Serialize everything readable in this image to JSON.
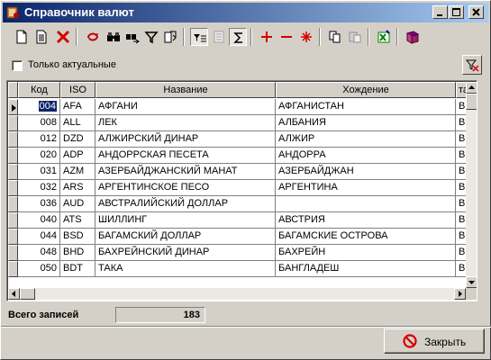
{
  "window": {
    "title": "Справочник валют"
  },
  "filter": {
    "checkbox_label": "Только актуальные",
    "checked": false
  },
  "columns": [
    "Код",
    "ISO",
    "Название",
    "Хождение",
    "татус"
  ],
  "rows": [
    {
      "code": "004",
      "iso": "AFA",
      "name": "АФГАНИ",
      "region": "АФГАНИСТАН",
      "status": "Вкл"
    },
    {
      "code": "008",
      "iso": "ALL",
      "name": "ЛЕК",
      "region": "АЛБАНИЯ",
      "status": "Вкл"
    },
    {
      "code": "012",
      "iso": "DZD",
      "name": "АЛЖИРСКИЙ ДИНАР",
      "region": "АЛЖИР",
      "status": "Вкл"
    },
    {
      "code": "020",
      "iso": "ADP",
      "name": "АНДОРРСКАЯ ПЕСЕТА",
      "region": "АНДОРРА",
      "status": "Вкл"
    },
    {
      "code": "031",
      "iso": "AZM",
      "name": "АЗЕРБАЙДЖАНСКИЙ МАНАТ",
      "region": "АЗЕРБАЙДЖАН",
      "status": "Вкл"
    },
    {
      "code": "032",
      "iso": "ARS",
      "name": "АРГЕНТИНСКОЕ ПЕСО",
      "region": "АРГЕНТИНА",
      "status": "Вкл"
    },
    {
      "code": "036",
      "iso": "AUD",
      "name": "АВСТРАЛИЙСКИЙ ДОЛЛАР",
      "region": "",
      "status": "Вкл"
    },
    {
      "code": "040",
      "iso": "ATS",
      "name": "ШИЛЛИНГ",
      "region": "АВСТРИЯ",
      "status": "Вкл"
    },
    {
      "code": "044",
      "iso": "BSD",
      "name": "БАГАМСКИЙ ДОЛЛАР",
      "region": "БАГАМСКИЕ ОСТРОВА",
      "status": "Вкл"
    },
    {
      "code": "048",
      "iso": "BHD",
      "name": "БАХРЕЙНСКИЙ ДИНАР",
      "region": "БАХРЕЙН",
      "status": "Вкл"
    },
    {
      "code": "050",
      "iso": "BDT",
      "name": "ТАКА",
      "region": "БАНГЛАДЕШ",
      "status": "Вкл"
    }
  ],
  "footer": {
    "total_label": "Всего записей",
    "total_value": "183",
    "close_label": "Закрыть"
  },
  "colors": {
    "title_start": "#0a246a",
    "title_end": "#a6caf0",
    "selection": "#0a246a",
    "delete_red": "#d40000",
    "face": "#d4d0c8"
  }
}
